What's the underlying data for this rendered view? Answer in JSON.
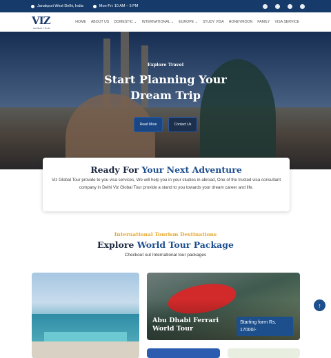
{
  "topbar": {
    "location": "Janakpuri West Delhi, India",
    "hours": "Mon-Fri: 10 AM – 5 PM"
  },
  "logo": {
    "text": "VIZ",
    "sub": "GLOBAL TOUR"
  },
  "menu": [
    "HOME",
    "ABOUT US",
    "DOMESTIC",
    "INTERNATIONAL",
    "EUROPE",
    "STUDY VISA",
    "HONEYMOON",
    "FAMILY",
    "VISA SERVICE"
  ],
  "hero": {
    "kicker": "Explore Travel",
    "title_line1": "Start Planning Your",
    "title_line2": "Dream Trip",
    "btn_primary": "Read More",
    "btn_secondary": "Contact Us"
  },
  "intro": {
    "title_a": "Ready For ",
    "title_b": "Your Next Adventure",
    "text": "Viz Global Tour provide to you visa services, We will help you in your studies in abroad, One of the trusted visa consultant company in Delhi Viz Global Tour provide a stand to you towards your dream career and life."
  },
  "packages": {
    "kicker": "International Tourism Destinations",
    "title_a": "Explore ",
    "title_b": "World Tour Package",
    "subtitle": "Checkout out International tour packages",
    "featured_name": "Abu Dhabi Ferrari World Tour",
    "featured_price": "Starting form Rs. 17000/-"
  },
  "colors": {
    "brand": "#163b6a",
    "accent": "#e5a82e"
  }
}
